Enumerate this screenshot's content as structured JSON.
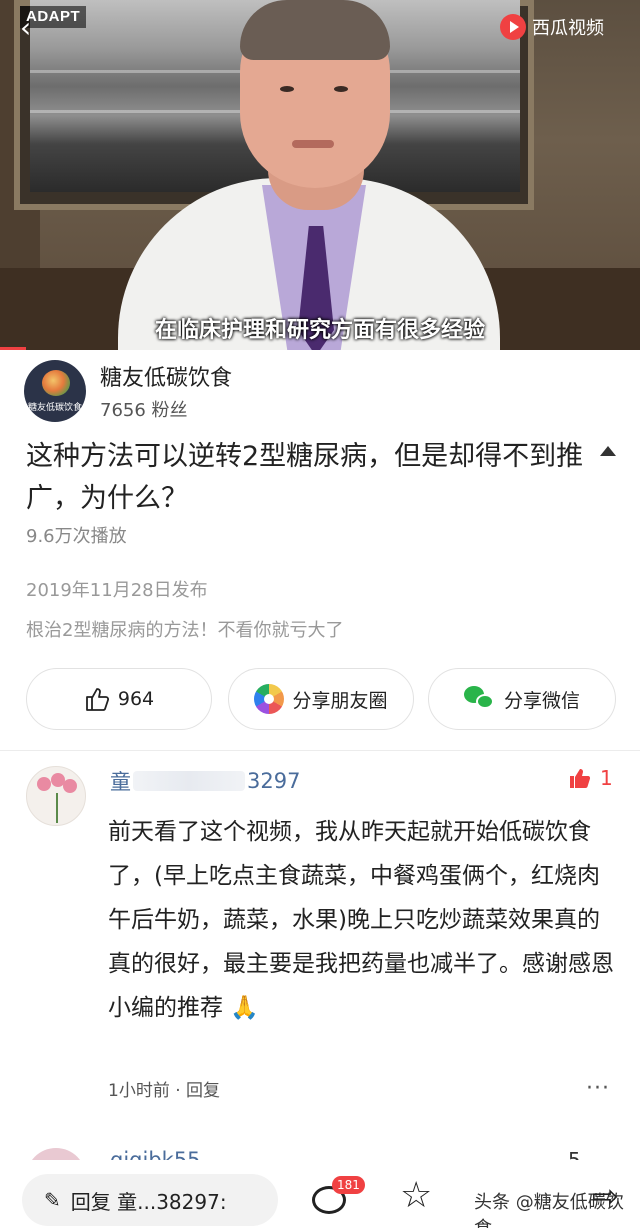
{
  "video": {
    "badge": "ADAPT",
    "back_glyph": "‹",
    "platform": "西瓜视频",
    "subtitle": "在临床护理和研究方面有很多经验",
    "progress": 0.04
  },
  "author": {
    "avatar_text": "糖友低碳饮食",
    "name": "糖友低碳饮食",
    "fans": "7656 粉丝"
  },
  "article": {
    "title": "这种方法可以逆转2型糖尿病，但是却得不到推广，为什么？",
    "plays": "9.6万次播放",
    "publish_date": "2019年11月28日发布",
    "summary": "根治2型糖尿病的方法！不看你就亏大了"
  },
  "actions": {
    "like_count": "964",
    "moments_label": "分享朋友圈",
    "wechat_label": "分享微信"
  },
  "comment": {
    "user_prefix": "童",
    "user_suffix": "3297",
    "likes": "1",
    "text": "前天看了这个视频，我从昨天起就开始低碳饮食了，(早上吃点主食蔬菜，中餐鸡蛋俩个，红烧肉午后牛奶，蔬菜，水果)晚上只吃炒蔬菜效果真的真的很好，最主要是我把药量也减半了。感谢感恩小编的推荐 🙏",
    "meta": "1小时前 · 回复",
    "more_glyph": "···"
  },
  "next_comment": {
    "user": "qiqibk55",
    "likes": "5"
  },
  "bottom_bar": {
    "reply_placeholder": "回复 童...38297:",
    "comment_count": "181",
    "watermark": "头条 @糖友低碳饮食"
  },
  "colors": {
    "accent_red": "#f04142",
    "username_blue": "#4a6c9b",
    "wechat_green": "#2ab44a"
  },
  "icons": [
    "back-icon",
    "play-logo-icon",
    "collapse-arrow-icon",
    "thumbs-up-icon",
    "moments-icon",
    "wechat-icon",
    "heart-thumb-icon",
    "more-icon",
    "pen-icon",
    "comment-icon",
    "star-icon",
    "share-icon"
  ]
}
